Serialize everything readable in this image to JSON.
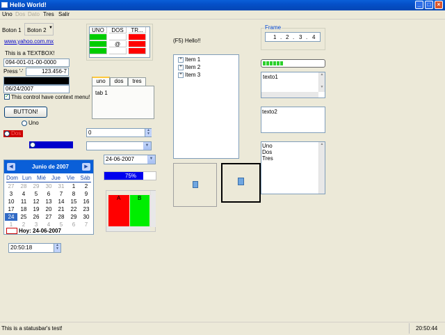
{
  "window": {
    "title": "Hello World!"
  },
  "menu": {
    "items": [
      "Uno",
      "Dos",
      "Dato",
      "Tres",
      "Salir"
    ]
  },
  "top_buttons": {
    "boton1": "Boton 1",
    "boton2": "Boton 2"
  },
  "link": "www.yahoo.com.mx",
  "textbox_label": "This is a TEXTBOX!",
  "masked": "094-001-01-00-0000",
  "press": {
    "label": "Press '-'",
    "value": "123.456-7"
  },
  "date_field": "06/24/2007",
  "context_check": {
    "label": "This control have context menu!",
    "checked": true
  },
  "big_button": "BUTTON!",
  "radio_uno": "Uno",
  "red_radio": "Dos",
  "grid": {
    "headers": [
      "UNO",
      "DOS",
      "TR..."
    ],
    "rows": [
      [
        "",
        "",
        ""
      ],
      [
        "",
        "@",
        ""
      ],
      [
        "",
        "",
        ""
      ]
    ],
    "colors": {
      "green": "#00cc00",
      "red": "#ff0000"
    }
  },
  "tabs": {
    "labels": [
      "uno",
      "dos",
      "tres"
    ],
    "content": "tab 1"
  },
  "spin_value": "0",
  "combo_value": "",
  "date_picker": "24-06-2007",
  "progress_blue": {
    "value": 75,
    "label": "75%"
  },
  "calendar": {
    "month_title": "Junio de 2007",
    "days_header": [
      "Dom",
      "Lun",
      "Mié",
      "Jue",
      "Vie",
      "Sáb"
    ],
    "rows": [
      [
        "27",
        "28",
        "29",
        "30",
        "31",
        "1",
        "2"
      ],
      [
        "3",
        "4",
        "5",
        "6",
        "7",
        "8",
        "9"
      ],
      [
        "10",
        "11",
        "12",
        "13",
        "14",
        "15",
        "16"
      ],
      [
        "17",
        "18",
        "19",
        "20",
        "21",
        "22",
        "23"
      ],
      [
        "24",
        "25",
        "26",
        "27",
        "28",
        "29",
        "30"
      ],
      [
        "1",
        "2",
        "3",
        "4",
        "5",
        "6",
        "7"
      ]
    ],
    "today_label": "Hoy: 24-06-2007"
  },
  "time_field": "20:50:18",
  "color_grid": {
    "headers": [
      "A",
      "B"
    ]
  },
  "f5_label": "(F5) Hello!!",
  "tree": {
    "items": [
      "Item 1",
      "Item 2",
      "Item 3"
    ]
  },
  "frame": {
    "title": "Frame",
    "values": [
      "1",
      "2",
      "3",
      "4"
    ]
  },
  "textareas": {
    "texto1": "texto1",
    "texto2": "texto2"
  },
  "progress_green": {
    "value": 0.35
  },
  "listbox": {
    "items": [
      "Uno",
      "Dos",
      "Tres"
    ]
  },
  "statusbar": {
    "text": "This is a statusbar's test!",
    "clock": "20:50:44"
  }
}
